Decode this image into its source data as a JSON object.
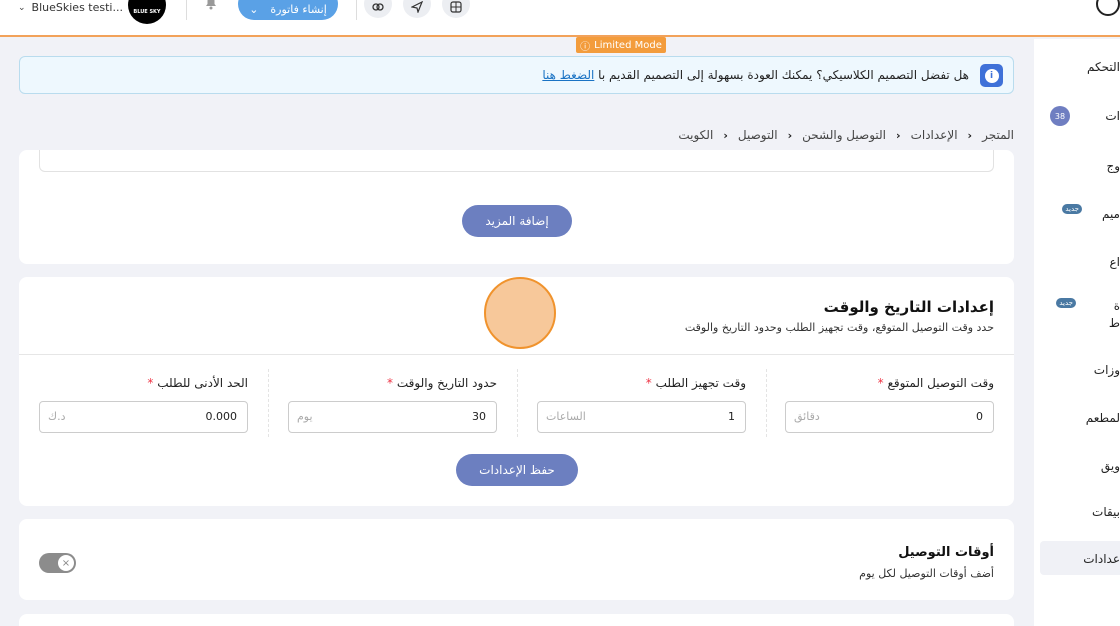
{
  "topbar": {
    "store_name": "BlueSkies testi...",
    "logo_text": "BLUE SKY",
    "create_invoice": "إنشاء فاتورة"
  },
  "limited_mode": "Limited Mode",
  "notice": {
    "text": "هل تفضل التصميم الكلاسيكي؟ يمكنك العودة بسهولة إلى التصميم القديم با ",
    "link": "الضغط هنا"
  },
  "breadcrumb": [
    "المتجر",
    "الإعدادات",
    "التوصيل والشحن",
    "التوصيل",
    "الكويت"
  ],
  "sidebar": {
    "items": [
      {
        "label": "التحكم"
      },
      {
        "label": "ات",
        "badge": "38"
      },
      {
        "label": "وج"
      },
      {
        "label": "ميم",
        "new_badge": "جديد"
      },
      {
        "label": "اع"
      },
      {
        "label": "ة",
        "label2": "ط",
        "new_badge": "جديد"
      },
      {
        "label": "وزات"
      },
      {
        "label": "لمطعم"
      },
      {
        "label": "ويق"
      },
      {
        "label": "بيقات"
      },
      {
        "label": "عدادات"
      }
    ]
  },
  "add_more_card": {
    "button": "إضافة المزيد"
  },
  "datetime_card": {
    "title": "إعدادات التاريخ والوقت",
    "subtitle": "حدد وقت التوصيل المتوقع، وقت تجهيز الطلب وحدود التاريخ والوقت",
    "fields": [
      {
        "label": "وقت التوصيل المتوقع",
        "value": "0",
        "unit": "دقائق"
      },
      {
        "label": "وقت تجهيز الطلب",
        "value": "1",
        "unit": "الساعات"
      },
      {
        "label": "حدود التاريخ والوقت",
        "value": "30",
        "unit": "يوم"
      },
      {
        "label": "الحد الأدنى للطلب",
        "value": "0.000",
        "unit": "د.ك"
      }
    ],
    "required_mark": "*",
    "save_button": "حفظ الإعدادات"
  },
  "delivery_times_card": {
    "title": "أوقات التوصيل",
    "subtitle": "أضف أوقات التوصيل لكل يوم",
    "toggle_on": false
  }
}
